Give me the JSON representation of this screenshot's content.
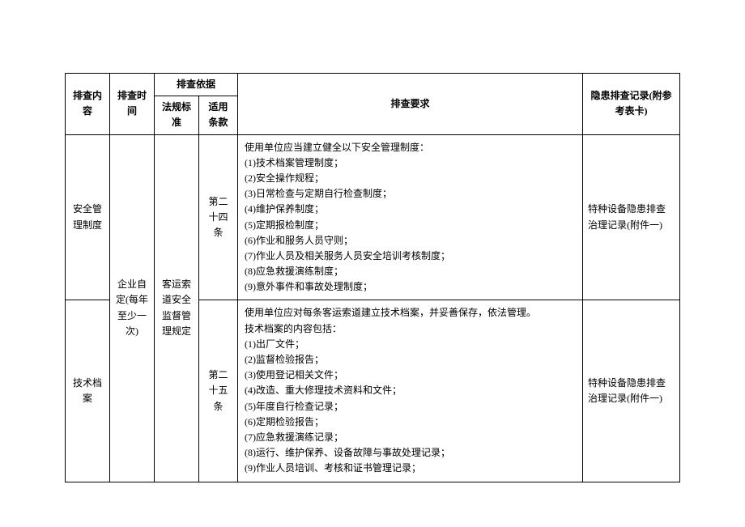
{
  "headers": {
    "col1": "排查内容",
    "col2": "排查时间",
    "basis_group": "排查依据",
    "basis_sub1": "法规标准",
    "basis_sub2": "适用条款",
    "col5": "排查要求",
    "col6": "隐患排查记录(附参考表卡)"
  },
  "shared": {
    "inspect_time": "企业自定(每年至少一次)",
    "regulation": "客运索道安全监督管理规定"
  },
  "rows": [
    {
      "content": "安全管理制度",
      "clause": "第二十四条",
      "requirements": [
        "使用单位应当建立健全以下安全管理制度：",
        "(1)技术档案管理制度；",
        "(2)安全操作规程；",
        "(3)日常检查与定期自行检查制度；",
        "(4)维护保养制度；",
        "(5)定期报检制度；",
        "(6)作业和服务人员守则；",
        "(7)作业人员及相关服务人员安全培训考核制度；",
        "(8)应急救援演练制度；",
        "(9)意外事件和事故处理制度；"
      ],
      "record": "特种设备隐患排查治理记录(附件一)"
    },
    {
      "content": "技术档案",
      "clause": "第二十五条",
      "requirements": [
        "使用单位应对每条客运索道建立技术档案，并妥善保存，依法管理。",
        "技术档案的内容包括：",
        "(1)出厂文件；",
        "(2)监督检验报告；",
        "(3)使用登记相关文件；",
        "(4)改造、重大修理技术资料和文件；",
        "(5)年度自行检查记录；",
        "(6)定期检验报告；",
        "(7)应急救援演练记录；",
        "(8)运行、维护保养、设备故障与事故处理记录；",
        "(9)作业人员培训、考核和证书管理记录；"
      ],
      "record": "特种设备隐患排查治理记录(附件一)"
    }
  ]
}
